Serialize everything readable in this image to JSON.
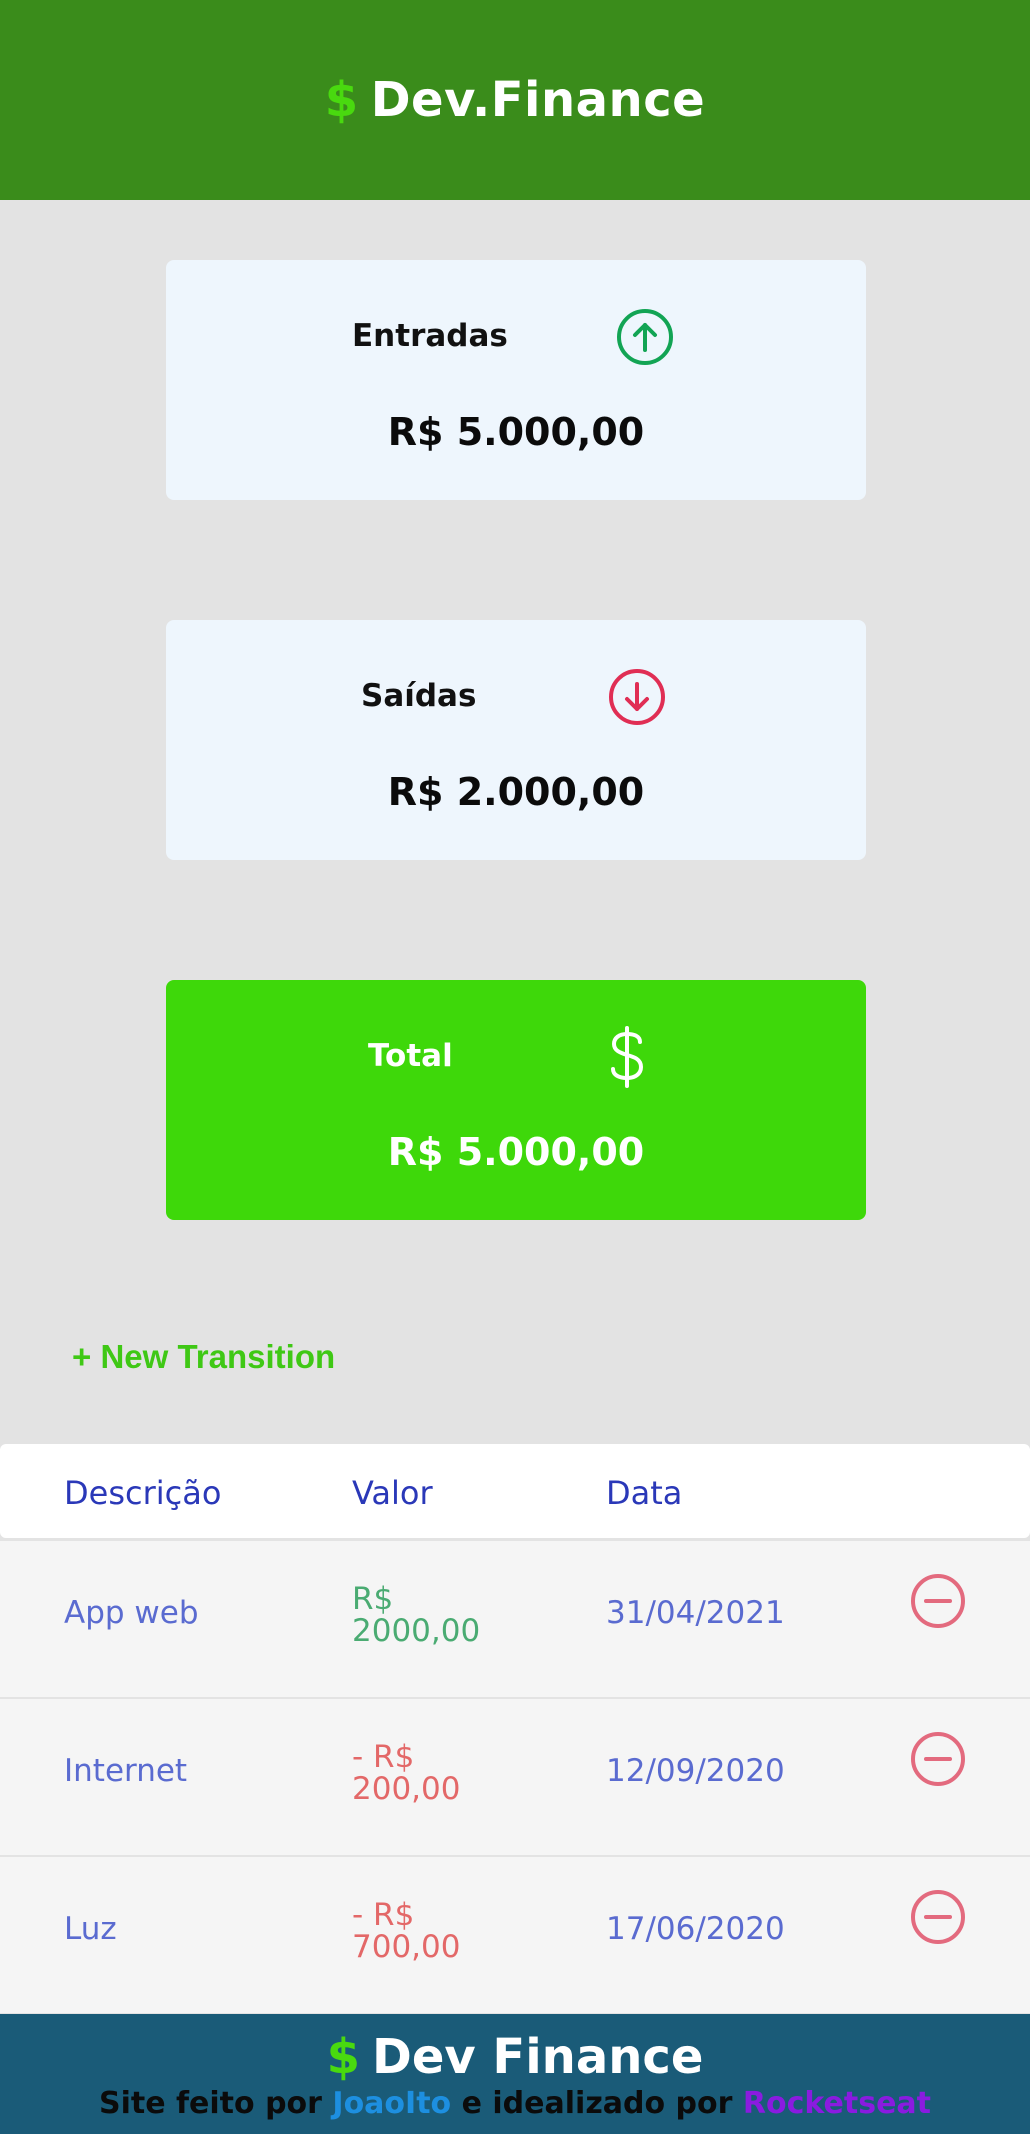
{
  "header": {
    "logo_symbol": "$",
    "logo_text": "Dev.Finance"
  },
  "cards": {
    "income": {
      "label": "Entradas",
      "icon": "arrow-up-circle-icon",
      "value": "R$ 5.000,00",
      "icon_color": "#12a454"
    },
    "expense": {
      "label": "Saídas",
      "icon": "arrow-down-circle-icon",
      "value": "R$ 2.000,00",
      "icon_color": "#e02e54"
    },
    "total": {
      "label": "Total",
      "icon": "dollar-sign-icon",
      "value": "R$ 5.000,00",
      "bg_color": "#3ed80a"
    }
  },
  "actions": {
    "new_transaction": "+ New Transition"
  },
  "table": {
    "headers": [
      "Descrição",
      "Valor",
      "Data"
    ],
    "rows": [
      {
        "description": "App web",
        "amount": "R$ 2000,00",
        "date": "31/04/2021",
        "type": "income"
      },
      {
        "description": "Internet",
        "amount": "- R$ 200,00",
        "date": "12/09/2020",
        "type": "expense"
      },
      {
        "description": "Luz",
        "amount": "- R$ 700,00",
        "date": "17/06/2020",
        "type": "expense"
      }
    ],
    "remove_icon": "minus-circle-icon"
  },
  "footer": {
    "logo_symbol": "$",
    "logo_text": "Dev Finance",
    "credit_prefix": "Site feito por",
    "author": "JoaoIto",
    "credit_middle": "e idealizado por",
    "org": "Rocketseat"
  },
  "colors": {
    "header_bg": "#3a8c1b",
    "accent_green": "#49d90f",
    "income_text": "#4aab72",
    "expense_text": "#e36868",
    "footer_bg": "#1a5b78"
  }
}
